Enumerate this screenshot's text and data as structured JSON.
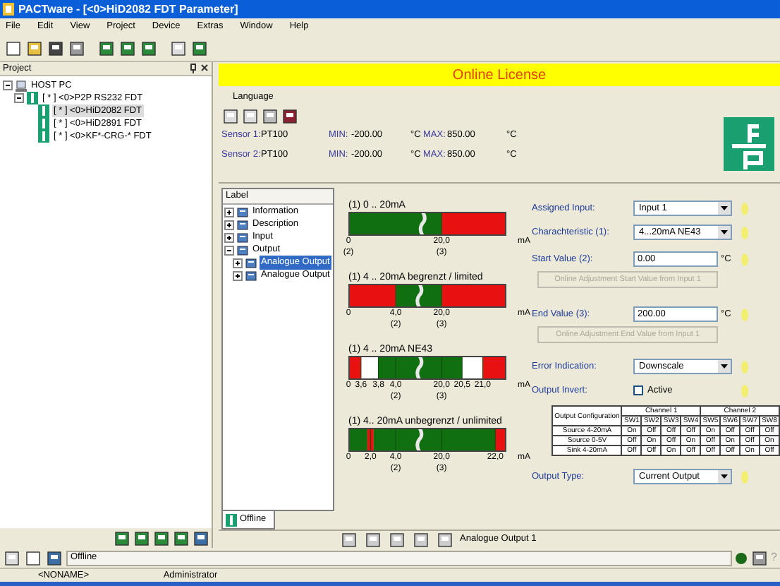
{
  "window": {
    "title": "PACTware - [<0>HiD2082 FDT Parameter]"
  },
  "menu": [
    "File",
    "Edit",
    "View",
    "Project",
    "Device",
    "Extras",
    "Window",
    "Help"
  ],
  "project_panel": {
    "title": "Project",
    "tree": [
      {
        "label": "HOST PC",
        "expanded": true,
        "children": [
          {
            "label": "[ * ] <0>P2P RS232 FDT",
            "expanded": true,
            "children": [
              {
                "label": "[ * ] <0>HiD2082 FDT",
                "selected": true
              },
              {
                "label": "[ * ] <0>HiD2891 FDT",
                "selected": false
              },
              {
                "label": "[ * ] <0>KF*-CRG-* FDT",
                "selected": false
              }
            ]
          }
        ]
      }
    ]
  },
  "banner": "Online License",
  "language_menu": "Language",
  "sensors": [
    {
      "label": "Sensor 1:",
      "type": "PT100",
      "min_label": "MIN:",
      "min": "-200.00",
      "min_unit": "°C",
      "max_label": "MAX:",
      "max": "850.00",
      "max_unit": "°C"
    },
    {
      "label": "Sensor 2:",
      "type": "PT100",
      "min_label": "MIN:",
      "min": "-200.00",
      "min_unit": "°C",
      "max_label": "MAX:",
      "max": "850.00",
      "max_unit": "°C"
    }
  ],
  "label_tree": {
    "header": "Label",
    "items": [
      {
        "label": "Information",
        "expanded": false
      },
      {
        "label": "Description",
        "expanded": false
      },
      {
        "label": "Input",
        "expanded": false
      },
      {
        "label": "Output",
        "expanded": true,
        "children": [
          {
            "label": "Analogue Output",
            "expanded": false,
            "selected": true
          },
          {
            "label": "Analogue Output",
            "expanded": false,
            "selected": false
          }
        ]
      }
    ]
  },
  "tab": {
    "label": "Offline"
  },
  "diagrams": [
    {
      "title": "(1) 0 .. 20mA",
      "unit": "mA",
      "segments": [
        {
          "color": "#107010"
        },
        {
          "color": "#e81010"
        }
      ],
      "ticks": [
        {
          "label": "0",
          "note": "(2)"
        },
        {
          "label": "20,0",
          "note": "(3)"
        }
      ]
    },
    {
      "title": "(1) 4 .. 20mA begrenzt / limited",
      "unit": "mA",
      "segments": [
        {
          "color": "#e81010"
        },
        {
          "color": "#107010"
        },
        {
          "color": "#e81010"
        }
      ],
      "ticks": [
        {
          "label": "0"
        },
        {
          "label": "4,0",
          "note": "(2)"
        },
        {
          "label": "20,0",
          "note": "(3)"
        }
      ]
    },
    {
      "title": "(1) 4 .. 20mA NE43",
      "unit": "mA",
      "segments": [
        {
          "color": "#e81010"
        },
        {
          "color": "#ffffff"
        },
        {
          "color": "#107010"
        },
        {
          "color": "#ffffff"
        },
        {
          "color": "#e81010"
        }
      ],
      "ticks": [
        {
          "label": "0"
        },
        {
          "label": "3,6"
        },
        {
          "label": "3,8"
        },
        {
          "label": "4,0",
          "note": "(2)"
        },
        {
          "label": "20,0",
          "note": "(3)"
        },
        {
          "label": "20,5"
        },
        {
          "label": "21,0"
        }
      ]
    },
    {
      "title": "(1) 4.. 20mA unbegrenzt / unlimited",
      "unit": "mA",
      "segments": [
        {
          "color": "#107010"
        },
        {
          "color": "#e81010"
        },
        {
          "color": "#107010"
        },
        {
          "color": "#e81010"
        }
      ],
      "ticks": [
        {
          "label": "0"
        },
        {
          "label": "2,0"
        },
        {
          "label": "4,0",
          "note": "(2)"
        },
        {
          "label": "20,0",
          "note": "(3)"
        },
        {
          "label": "22,0"
        }
      ]
    }
  ],
  "form": [
    {
      "kind": "select",
      "label": "Assigned Input:",
      "value": "Input 1"
    },
    {
      "kind": "select",
      "label": "Charachteristic (1):",
      "value": "4...20mA NE43"
    },
    {
      "kind": "input",
      "label": "Start Value (2):",
      "value": "0.00",
      "unit": "°C"
    },
    {
      "kind": "button",
      "label": "Online Adjustment Start Value from Input 1",
      "disabled": true
    },
    {
      "kind": "input",
      "label": "End Value (3):",
      "value": "200.00",
      "unit": "°C"
    },
    {
      "kind": "button",
      "label": "Online Adjustment End Value from Input 1",
      "disabled": true
    },
    {
      "kind": "select",
      "label": "Error Indication:",
      "value": "Downscale"
    },
    {
      "kind": "checkbox",
      "label": "Output Invert:",
      "text": "Active",
      "checked": false
    },
    {
      "kind": "table",
      "corner": "Output Configuration",
      "groups": [
        "Channel 1",
        "Channel 2"
      ],
      "columns": [
        "SW1",
        "SW2",
        "SW3",
        "SW4",
        "SW5",
        "SW6",
        "SW7",
        "SW8"
      ],
      "rows": [
        {
          "label": "Source 4-20mA",
          "cells": [
            "On",
            "Off",
            "Off",
            "Off",
            "On",
            "Off",
            "Off",
            "Off"
          ]
        },
        {
          "label": "Source 0-5V",
          "cells": [
            "Off",
            "On",
            "Off",
            "On",
            "Off",
            "On",
            "Off",
            "On"
          ]
        },
        {
          "label": "Sink 4-20mA",
          "cells": [
            "Off",
            "Off",
            "On",
            "Off",
            "Off",
            "Off",
            "On",
            "Off"
          ]
        }
      ]
    },
    {
      "kind": "select",
      "label": "Output Type:",
      "value": "Current Output"
    }
  ],
  "child_toolbar": {
    "caption": "Analogue Output 1"
  },
  "status_bar": {
    "text": "Offline",
    "help": "?"
  },
  "bottom_bar": {
    "project": "<NONAME>",
    "user": "Administrator"
  }
}
